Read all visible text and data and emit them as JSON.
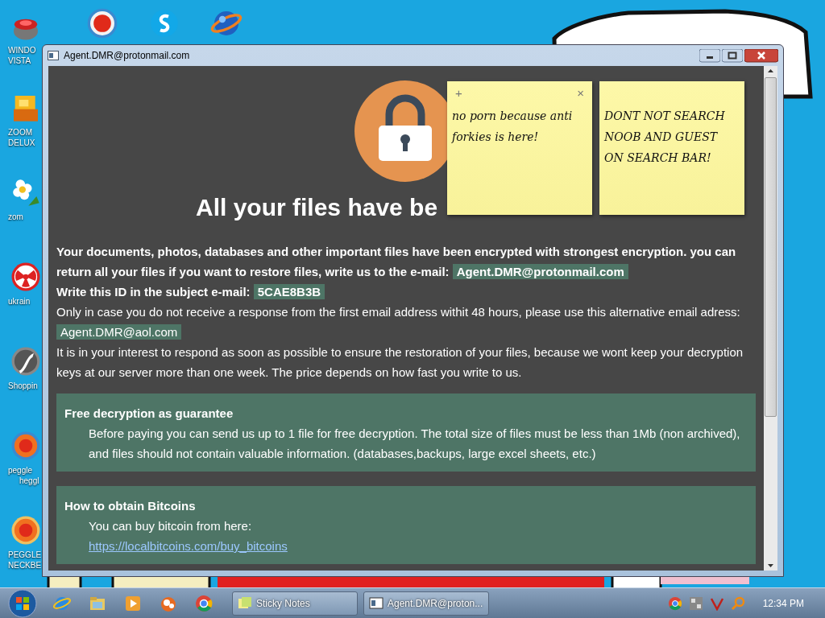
{
  "desktop_icons": [
    {
      "label_lines": [
        "WINDO",
        "VISTA"
      ]
    },
    {
      "label_lines": [
        "ZOOM",
        "DELUX"
      ]
    },
    {
      "label_lines": [
        "zom"
      ]
    },
    {
      "label_lines": [
        "ukrain"
      ]
    },
    {
      "label_lines": [
        "Shoppin"
      ]
    },
    {
      "label_lines": [
        "peggle",
        "heggl"
      ]
    },
    {
      "label_lines": [
        "PEGGLE",
        "NECKBE"
      ]
    }
  ],
  "window": {
    "title": "Agent.DMR@protonmail.com",
    "heading": "All your files have be",
    "message": [
      {
        "kind": "bold",
        "text": "Your documents, photos, databases and other important files have been encrypted with strongest encryption. you can return all your files if you want to restore files, write us to the e-mail:",
        "tag": "Agent.DMR@protonmail.com"
      },
      {
        "kind": "bold",
        "text": "Write this ID in the subject e-mail:",
        "tag": "5CAE8B3B"
      },
      {
        "kind": "plain",
        "text": "Only in case you do not receive a response from the first email address withit 48 hours, please use this alternative email adress:",
        "tag": "Agent.DMR@aol.com"
      },
      {
        "kind": "plain",
        "text": "It is in your interest to respond as soon as possible to ensure the restoration of your files, because we wont keep your decryption keys at our server more than one week. The price depends on how fast you write to us."
      }
    ],
    "boxes": [
      {
        "title": "Free decryption as guarantee",
        "text": "Before paying you can send us up to 1 file for free decryption. The total size of files must be less than 1Mb (non archived), and files should not contain valuable information. (databases,backups, large excel sheets, etc.)"
      },
      {
        "title": "How to obtain Bitcoins",
        "text": "You can buy bitcoin from here:",
        "link": "https://localbitcoins.com/buy_bitcoins"
      }
    ]
  },
  "sticky_notes": [
    {
      "add": "+",
      "close": "×",
      "text": "no porn because anti forkies is here!"
    },
    {
      "text": "DONT NOT SEARCH NOOB AND GUEST ON SEARCH BAR!"
    }
  ],
  "taskbar": {
    "tasks": [
      "Sticky Notes",
      "Agent.DMR@proton..."
    ],
    "clock": "12:34 PM"
  }
}
